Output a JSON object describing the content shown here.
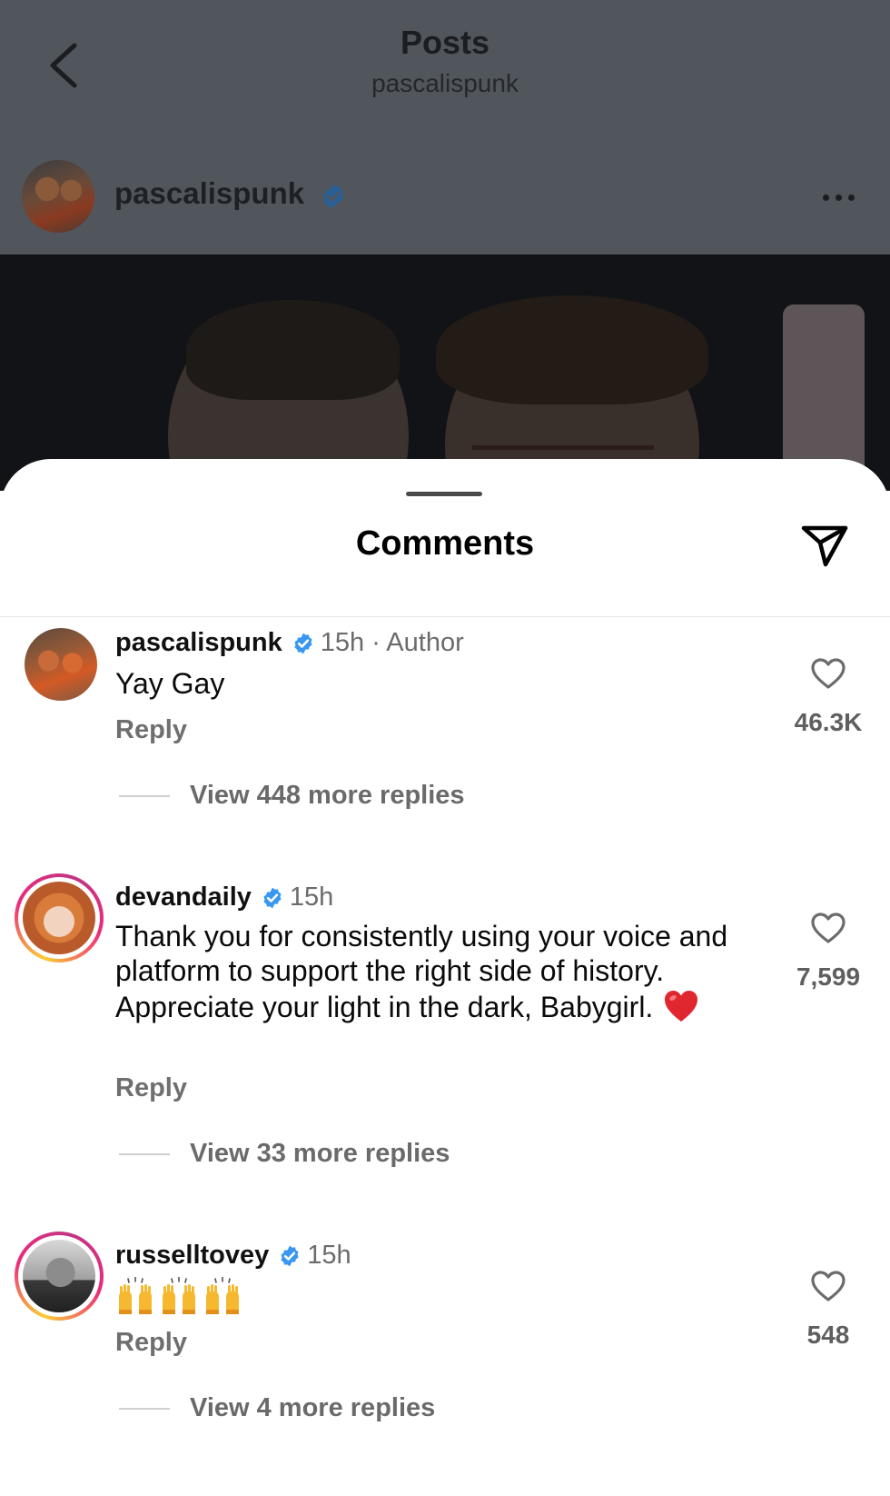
{
  "nav": {
    "title": "Posts",
    "subtitle": "pascalispunk"
  },
  "post": {
    "author": "pascalispunk",
    "verified": true
  },
  "sheet": {
    "title": "Comments"
  },
  "comments": [
    {
      "user": "pascalispunk",
      "verified": true,
      "time": "15h · Author",
      "text": "Yay Gay",
      "reply_label": "Reply",
      "likes": "46.3K",
      "view_replies": "View 448 more replies"
    },
    {
      "user": "devandaily",
      "verified": true,
      "time": "15h",
      "text": "Thank you for consistently using your voice and platform to support the right side of history. Appreciate your light in the dark, Babygirl.",
      "emoji": "red-heart",
      "reply_label": "Reply",
      "likes": "7,599",
      "view_replies": "View 33 more replies"
    },
    {
      "user": "russelltovey",
      "verified": true,
      "time": "15h",
      "emoji": "raising-hands x3",
      "reply_label": "Reply",
      "likes": "548",
      "view_replies": "View 4 more replies"
    }
  ],
  "colors": {
    "overlay": "#51565c",
    "verified_blue": "#3897f0",
    "heart_red": "#e0262f",
    "story_ring": [
      "#f9ce34",
      "#ee2a7b",
      "#c13584"
    ]
  }
}
